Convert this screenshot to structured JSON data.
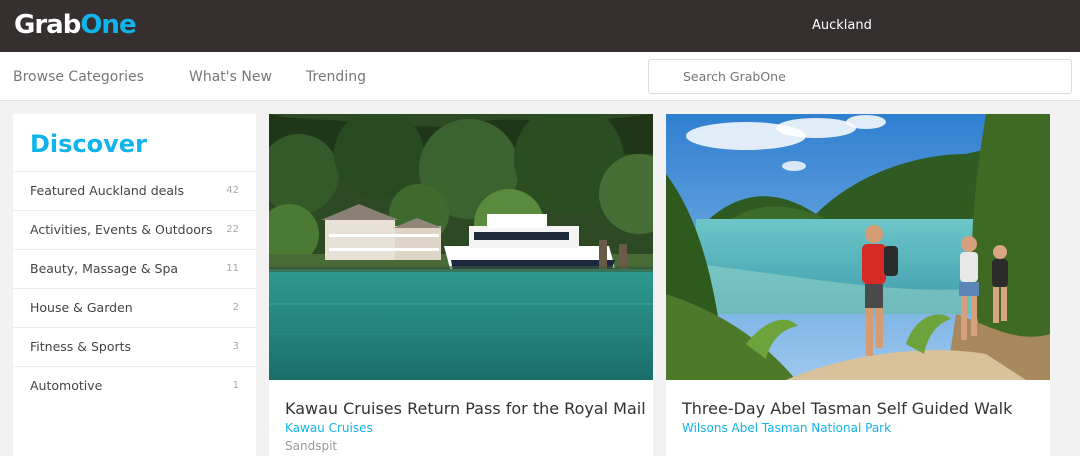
{
  "header": {
    "logo": {
      "part1": "Grab",
      "part2": "One"
    },
    "location": "Auckland"
  },
  "nav": {
    "links": [
      "Browse Categories",
      "What's New",
      "Trending"
    ],
    "search_placeholder": "Search GrabOne"
  },
  "sidebar": {
    "title": "Discover",
    "categories": [
      {
        "label": "Featured Auckland deals",
        "count": "42"
      },
      {
        "label": "Activities, Events & Outdoors",
        "count": "22"
      },
      {
        "label": "Beauty, Massage & Spa",
        "count": "11"
      },
      {
        "label": "House & Garden",
        "count": "2"
      },
      {
        "label": "Fitness & Sports",
        "count": "3"
      },
      {
        "label": "Automotive",
        "count": "1"
      }
    ]
  },
  "deals": [
    {
      "title": "Kawau Cruises Return Pass for the Royal Mail",
      "merchant": "Kawau Cruises",
      "location": "Sandspit",
      "image": "photo of a white ferry at a jetty with a historic house and bush"
    },
    {
      "title": "Three-Day Abel Tasman Self Guided Walk",
      "merchant": "Wilsons Abel Tasman National Park",
      "location": "",
      "image": "photo of hikers on a coastal track above a turquoise bay"
    }
  ]
}
